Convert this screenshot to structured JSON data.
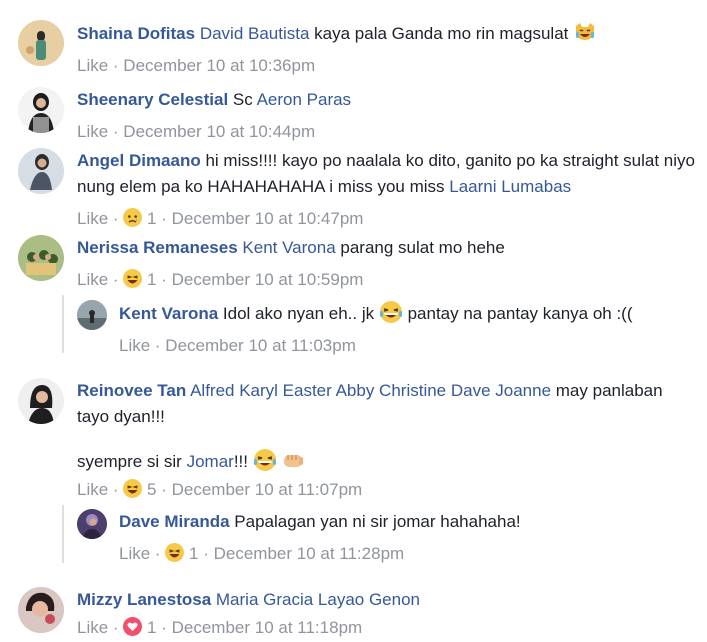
{
  "comments": [
    {
      "author": "Shaina Dofitas",
      "segments": [
        {
          "t": "mention",
          "v": "David Bautista"
        },
        {
          "t": "text",
          "v": " kaya pala Ganda mo rin magsulat "
        }
      ],
      "emoji": "laughing-cat-emoji",
      "like": "Like",
      "time": "December 10 at 10:36pm"
    },
    {
      "author": "Sheenary Celestial",
      "text": " Sc ",
      "mention": "Aeron Paras",
      "like": "Like",
      "time": "December 10 at 10:44pm"
    },
    {
      "author": "Angel Dimaano",
      "text": " hi miss!!!! kayo po naalala ko dito, ganito po ka straight sulat niyo nung elem pa ko HAHAHAHAHA i miss you miss ",
      "mention": "Laarni Lumabas",
      "like": "Like",
      "reaction_count": "1",
      "time": "December 10 at 10:47pm"
    },
    {
      "author": "Nerissa Remaneses",
      "mention": "Kent Varona",
      "text": " parang sulat mo hehe",
      "like": "Like",
      "reaction_count": "1",
      "time": "December 10 at 10:59pm",
      "reply": {
        "author": "Kent Varona",
        "text": " Idol ako nyan eh.. jk ",
        "text2": " pantay na pantay kanya oh :((",
        "like": "Like",
        "time": "December 10 at 11:03pm"
      }
    },
    {
      "author": "Reinovee Tan",
      "mention": "Alfred Karyl Easter Abby Christine Dave Joanne",
      "text": " may panlaban tayo dyan!!!",
      "para2": "syempre si sir ",
      "para2_mention": "Jomar",
      "para2_tail": "!!! ",
      "like": "Like",
      "reaction_count": "5",
      "time": "December 10 at 11:07pm",
      "reply": {
        "author": "Dave Miranda",
        "text": " Papalagan yan ni sir jomar hahahaha!",
        "like": "Like",
        "reaction_count": "1",
        "time": "December 10 at 11:28pm"
      }
    },
    {
      "author": "Mizzy Lanestosa",
      "mention": "Maria Gracia Layao Genon",
      "like": "Like",
      "reaction_count": "1",
      "time": "December 10 at 11:18pm"
    }
  ],
  "separator": " · ",
  "colors": {
    "link": "#365899",
    "meta": "#90949c",
    "text": "#1d2129"
  }
}
